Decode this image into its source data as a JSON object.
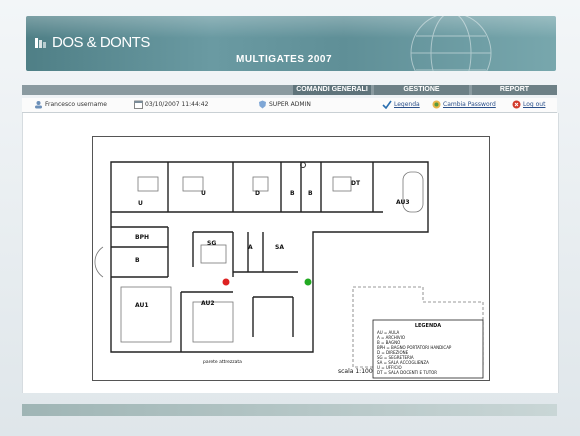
{
  "brand": {
    "logo_text": "DOS & DONTS",
    "app_title": "MULTIGATES 2007"
  },
  "menu": [
    {
      "label": "COMANDI GENERALI"
    },
    {
      "label": "GESTIONE"
    },
    {
      "label": "REPORT"
    }
  ],
  "status": {
    "user": "Francesco username",
    "datetime": "03/10/2007 11:44:42",
    "role": "SUPER ADMIN",
    "legend_link": "Legenda",
    "password_link": "Cambia Password",
    "logout_link": "Log out"
  },
  "plan": {
    "rooms": [
      "U",
      "U",
      "D",
      "B",
      "B",
      "DT",
      "AU3",
      "BPH",
      "B",
      "SG",
      "A",
      "SA",
      "AU1",
      "AU2"
    ],
    "note": "parete attrezzata",
    "scale": "scala 1:100",
    "legend": {
      "title": "LEGENDA",
      "items": [
        "AU = AULA",
        "A = ARCHIVIO",
        "B = BAGNO",
        "BPH = BAGNO PORTATORI HANDICAP",
        "D = DIREZIONE",
        "SG = SEGRETERIA",
        "SA = SALA ACCOGLIENZA",
        "U = UFFICIO",
        "DT = SALA DOCENTI E TUTOR"
      ]
    }
  }
}
